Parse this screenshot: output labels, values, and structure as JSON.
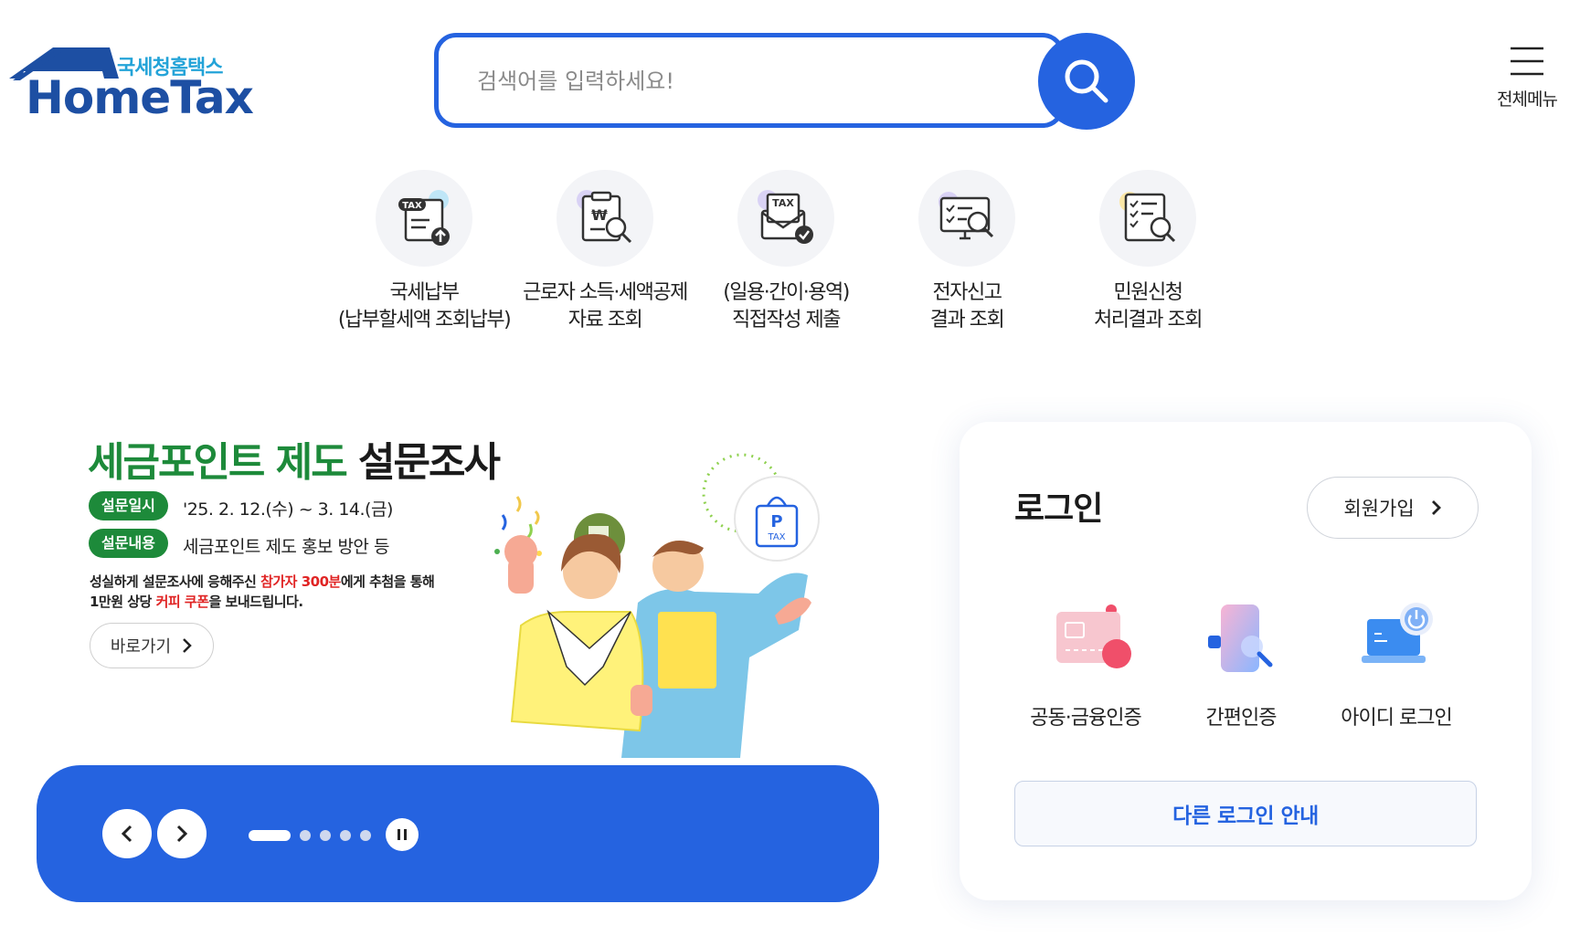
{
  "logo": {
    "sub": "국세청홈택스",
    "main": "HomeTax"
  },
  "search": {
    "placeholder": "검색어를 입력하세요!",
    "button_icon": "search-icon"
  },
  "menu": {
    "label": "전체메뉴",
    "icon": "hamburger-icon"
  },
  "quick_menu": [
    {
      "label": "국세납부\n(납부할세액 조회납부)",
      "icon": "tax-payment-icon"
    },
    {
      "label": "근로자 소득·세액공제\n자료 조회",
      "icon": "won-document-search-icon"
    },
    {
      "label": "(일용·간이·용역)\n직접작성 제출",
      "icon": "tax-envelope-check-icon"
    },
    {
      "label": "전자신고\n결과 조회",
      "icon": "monitor-search-icon"
    },
    {
      "label": "민원신청\n처리결과 조회",
      "icon": "checklist-search-icon"
    }
  ],
  "banner": {
    "title_green": "세금포인트 제도",
    "title_black": "설문조사",
    "period_label": "설문일시",
    "period_value": "'25. 2. 12.(수) ~ 3. 14.(금)",
    "content_label": "설문내용",
    "content_value": "세금포인트 제도 홍보 방안 등",
    "desc_line1_a": "성실하게 설문조사에 응해주신 ",
    "desc_line1_red": "참가자 300분",
    "desc_line1_b": "에게 추첨을 통해",
    "desc_line2_a": "1만원 상당 ",
    "desc_line2_red": "커피 쿠폰",
    "desc_line2_b": "을 보내드립니다.",
    "goto_label": "바로가기",
    "bag_p": "P",
    "bag_tax": "TAX",
    "slides_total": 5,
    "slide_active": 1
  },
  "login": {
    "title": "로그인",
    "join_label": "회원가입",
    "options": [
      {
        "label": "공동·금융인증",
        "icon": "certificate-card-icon"
      },
      {
        "label": "간편인증",
        "icon": "phone-search-icon"
      },
      {
        "label": "아이디 로그인",
        "icon": "laptop-power-icon"
      }
    ],
    "other_login": "다른 로그인 안내"
  },
  "colors": {
    "brand_blue": "#2563e0",
    "green": "#1d8a3a",
    "red": "#e02424",
    "logo_navy": "#1d4fa3"
  }
}
